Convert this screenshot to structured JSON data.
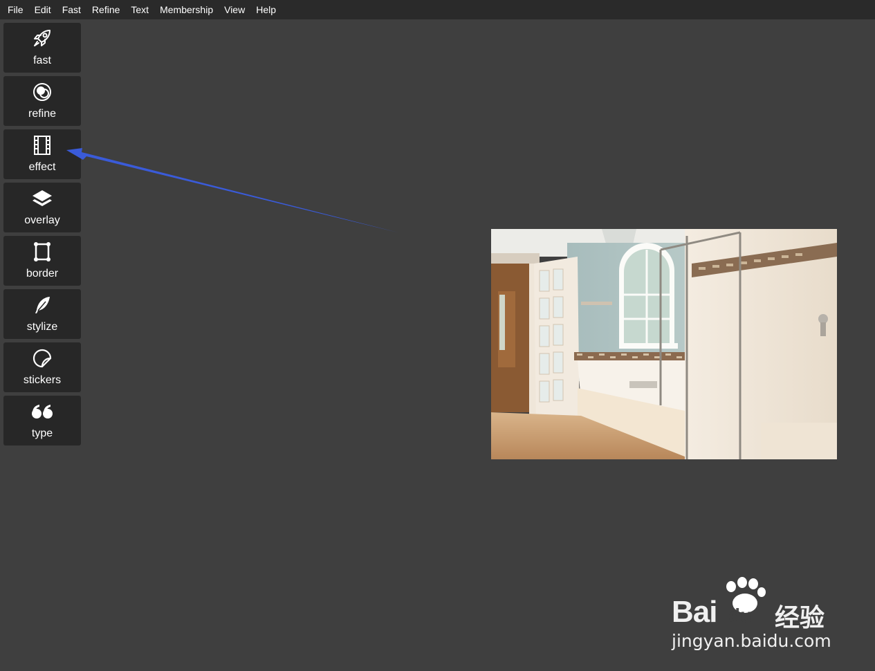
{
  "menubar": {
    "items": [
      "File",
      "Edit",
      "Fast",
      "Refine",
      "Text",
      "Membership",
      "View",
      "Help"
    ]
  },
  "toolbar": {
    "tools": [
      {
        "label": "fast",
        "icon": "rocket-icon"
      },
      {
        "label": "refine",
        "icon": "refine-circles-icon"
      },
      {
        "label": "effect",
        "icon": "film-strip-icon"
      },
      {
        "label": "overlay",
        "icon": "layers-icon"
      },
      {
        "label": "border",
        "icon": "frame-border-icon"
      },
      {
        "label": "stylize",
        "icon": "feather-icon"
      },
      {
        "label": "stickers",
        "icon": "sticker-icon"
      },
      {
        "label": "type",
        "icon": "quote-icon"
      }
    ]
  },
  "annotation": {
    "color": "#3a5bd9",
    "icon": "arrow-pointer-icon"
  },
  "canvas": {
    "photo_subject": "bathroom-photo"
  },
  "watermark": {
    "brand_bai": "Bai",
    "brand_du": "du",
    "brand_cn": "经验",
    "url": "jingyan.baidu.com"
  },
  "colors": {
    "background": "#3f3f3f",
    "menubar": "#2a2a2a",
    "tool_bg": "#272727",
    "text": "#ffffff"
  }
}
